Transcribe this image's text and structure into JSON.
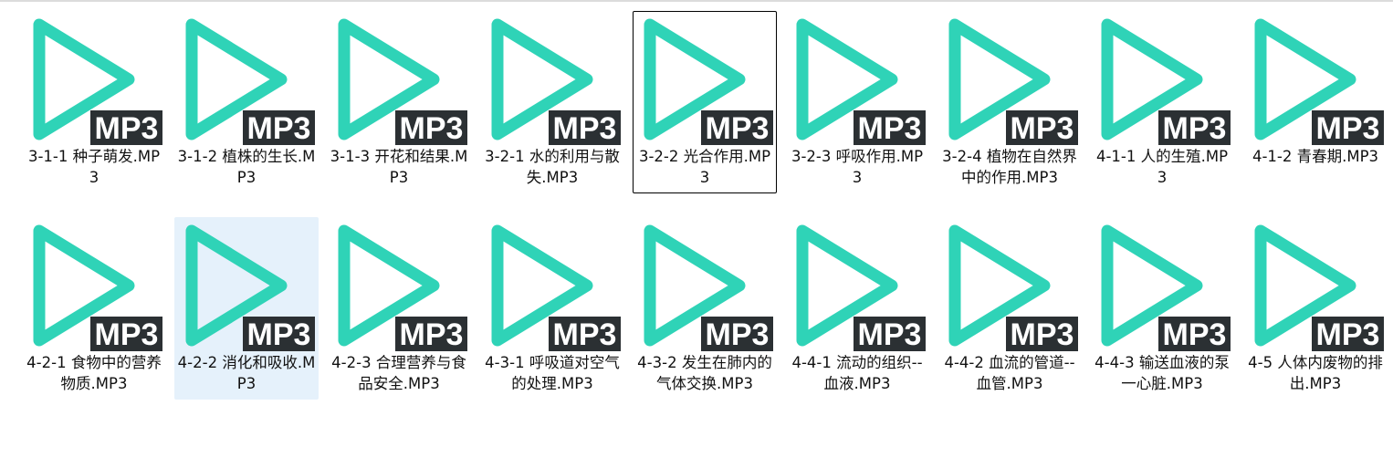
{
  "colors": {
    "icon_teal": "#2fd3b7",
    "badge_bg": "#2b3033",
    "badge_text": "#ffffff",
    "selected_bg": "#e5f1fb",
    "focus_border": "#000000"
  },
  "badge_text": "MP3",
  "files": [
    {
      "name": "3-1-1 种子萌发.MP3",
      "state": "normal"
    },
    {
      "name": "3-1-2 植株的生长.MP3",
      "state": "normal"
    },
    {
      "name": "3-1-3 开花和结果.MP3",
      "state": "normal"
    },
    {
      "name": "3-2-1 水的利用与散失.MP3",
      "state": "normal"
    },
    {
      "name": "3-2-2 光合作用.MP3",
      "state": "focused"
    },
    {
      "name": "3-2-3 呼吸作用.MP3",
      "state": "normal"
    },
    {
      "name": "3-2-4 植物在自然界中的作用.MP3",
      "state": "normal"
    },
    {
      "name": "4-1-1 人的生殖.MP3",
      "state": "normal"
    },
    {
      "name": "4-1-2 青春期.MP3",
      "state": "normal"
    },
    {
      "name": "4-2-1 食物中的营养物质.MP3",
      "state": "normal"
    },
    {
      "name": "4-2-2 消化和吸收.MP3",
      "state": "selected"
    },
    {
      "name": "4-2-3 合理营养与食品安全.MP3",
      "state": "normal"
    },
    {
      "name": "4-3-1 呼吸道对空气的处理.MP3",
      "state": "normal"
    },
    {
      "name": "4-3-2 发生在肺内的气体交换.MP3",
      "state": "normal"
    },
    {
      "name": "4-4-1 流动的组织--血液.MP3",
      "state": "normal"
    },
    {
      "name": "4-4-2 血流的管道--血管.MP3",
      "state": "normal"
    },
    {
      "name": "4-4-3 输送血液的泵一心脏.MP3",
      "state": "normal"
    },
    {
      "name": "4-5 人体内废物的排出.MP3",
      "state": "normal"
    }
  ]
}
